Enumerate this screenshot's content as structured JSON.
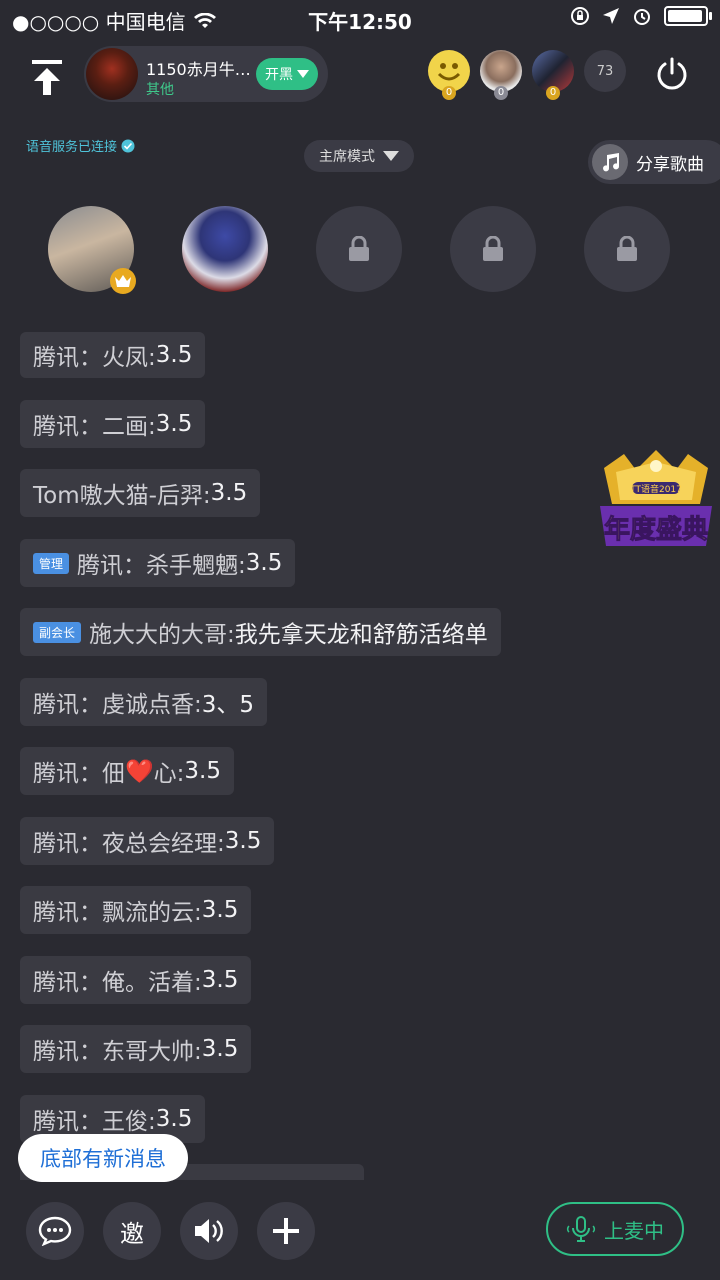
{
  "status_bar": {
    "carrier": "●○○○○ 中国电信",
    "time": "下午12:50"
  },
  "header": {
    "room_title": "1150赤月牛…",
    "room_category": "其他",
    "kaihei_label": "开黑",
    "viewer_badges": [
      "0",
      "0",
      "0"
    ],
    "online_count": "73"
  },
  "voice_status": "语音服务已连接",
  "mode_label": "主席模式",
  "share_label": "分享歌曲",
  "messages": [
    {
      "nick": "腾讯：火凤:",
      "text": " 3.5"
    },
    {
      "nick": "腾讯：二画:",
      "text": " 3.5"
    },
    {
      "nick": "Tom嗷大猫-后羿:",
      "text": " 3.5"
    },
    {
      "tag": "管理",
      "nick": "腾讯：杀手魍魉:",
      "text": " 3.5"
    },
    {
      "tag": "副会长",
      "nick": "施大大的大哥:",
      "text": " 我先拿天龙和舒筋活络单"
    },
    {
      "nick": "腾讯：虔诚点香:",
      "text": " 3、5"
    },
    {
      "nick_a": "腾讯：佃",
      "heart": "❤️",
      "nick_b": "心:",
      "text": " 3.5"
    },
    {
      "nick": "腾讯：夜总会经理:",
      "text": " 3.5"
    },
    {
      "nick": "腾讯：飘流的云:",
      "text": " 3.5"
    },
    {
      "nick": "腾讯：俺。活着:",
      "text": " 3.5"
    },
    {
      "nick": "腾讯：东哥大帅:",
      "text": " 3.5"
    },
    {
      "nick": "腾讯：王俊:",
      "text": " 3.5"
    }
  ],
  "banner": {
    "top_text": "TT语音2017",
    "main_text": "年度盛典"
  },
  "new_message_label": "底部有新消息",
  "bottom": {
    "invite_label": "邀",
    "mic_label": "上麦中"
  },
  "colors": {
    "accent_green": "#2fbf86",
    "bg": "#2a2a31",
    "link_blue": "#1f6fd6"
  }
}
